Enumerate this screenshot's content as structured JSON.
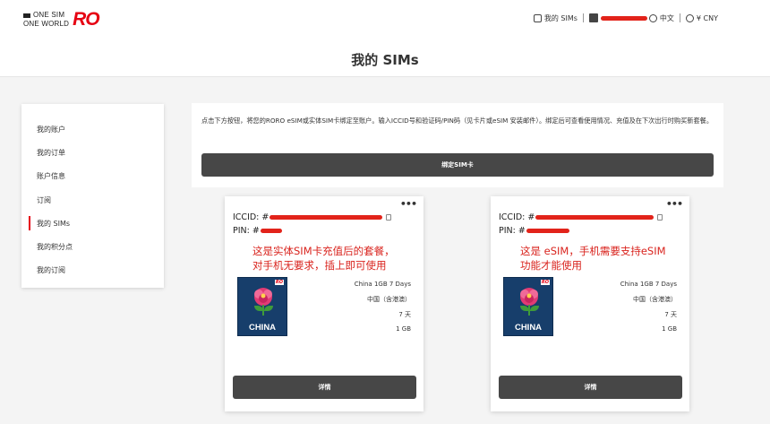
{
  "header": {
    "logo_line1": "ONE SIM",
    "logo_line2": "ONE WORLD",
    "logo_mark": "RO",
    "nav": {
      "my_sims": "我的 SIMs",
      "language": "中文",
      "currency": "¥ CNY"
    }
  },
  "page_title": "我的 SIMs",
  "sidebar": {
    "items": [
      {
        "label": "我的账户"
      },
      {
        "label": "我的订单"
      },
      {
        "label": "账户信息"
      },
      {
        "label": "订阅"
      },
      {
        "label": "我的 SIMs"
      },
      {
        "label": "我的积分点"
      },
      {
        "label": "我的订阅"
      }
    ],
    "active_index": 4
  },
  "bind": {
    "description": "点击下方按钮，将您的RORO eSIM或实体SIM卡绑定至账户。输入ICCID号和验证码/PIN码（见卡片或eSIM 安装邮件）。绑定后可查看使用情况、充值及在下次出行时购买新套餐。",
    "button_label": "绑定SIM卡"
  },
  "cards": [
    {
      "menu": "•••",
      "iccid_label": "ICCID: #",
      "pin_label": "PIN: #",
      "annotation_line1": "这是实体SIM卡充值后的套餐，",
      "annotation_line2": "对手机无要求，插上即可使用",
      "flag_tag": "RO",
      "flag_country": "CHINA",
      "plan_name": "China 1GB 7 Days",
      "region": "中国（含港澳）",
      "duration": "7 天",
      "data": "1 GB",
      "button_label": "详情"
    },
    {
      "menu": "•••",
      "iccid_label": "ICCID: #",
      "pin_label": "PIN: #",
      "annotation_line1": "这是 eSIM，手机需要支持eSIM",
      "annotation_line2": "功能才能使用",
      "flag_tag": "RO",
      "flag_country": "CHINA",
      "plan_name": "China 1GB 7 Days",
      "region": "中国（含港澳）",
      "duration": "7 天",
      "data": "1 GB",
      "button_label": "详情"
    }
  ],
  "colors": {
    "brand_red": "#e60012",
    "annotation_red": "#d9231d",
    "button_dark": "#474747",
    "flag_blue": "#173e6b"
  }
}
